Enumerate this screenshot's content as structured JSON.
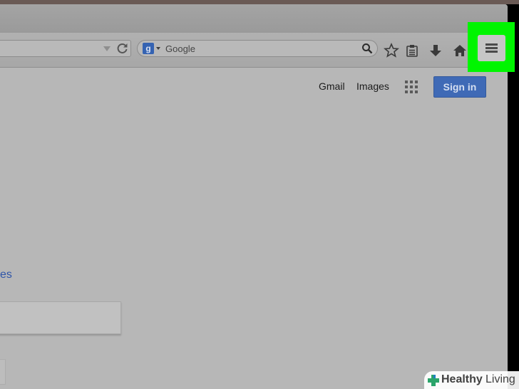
{
  "browser": {
    "search": {
      "placeholder": "Google",
      "engine_icon_letter": "g"
    }
  },
  "toolbar": {
    "icons": [
      "bookmark-star-icon",
      "reading-list-icon",
      "download-icon",
      "home-icon",
      "hamburger-menu-icon"
    ]
  },
  "page": {
    "links": {
      "gmail": "Gmail",
      "images": "Images"
    },
    "signin_label": "Sign in",
    "partial_link": "es"
  },
  "watermark": {
    "bold": "Healthy",
    "light": "Living"
  },
  "colors": {
    "highlight": "#00f500",
    "signin": "#3f6ab6",
    "link": "#2f55a8",
    "page_bg": "#b7b7b7"
  }
}
